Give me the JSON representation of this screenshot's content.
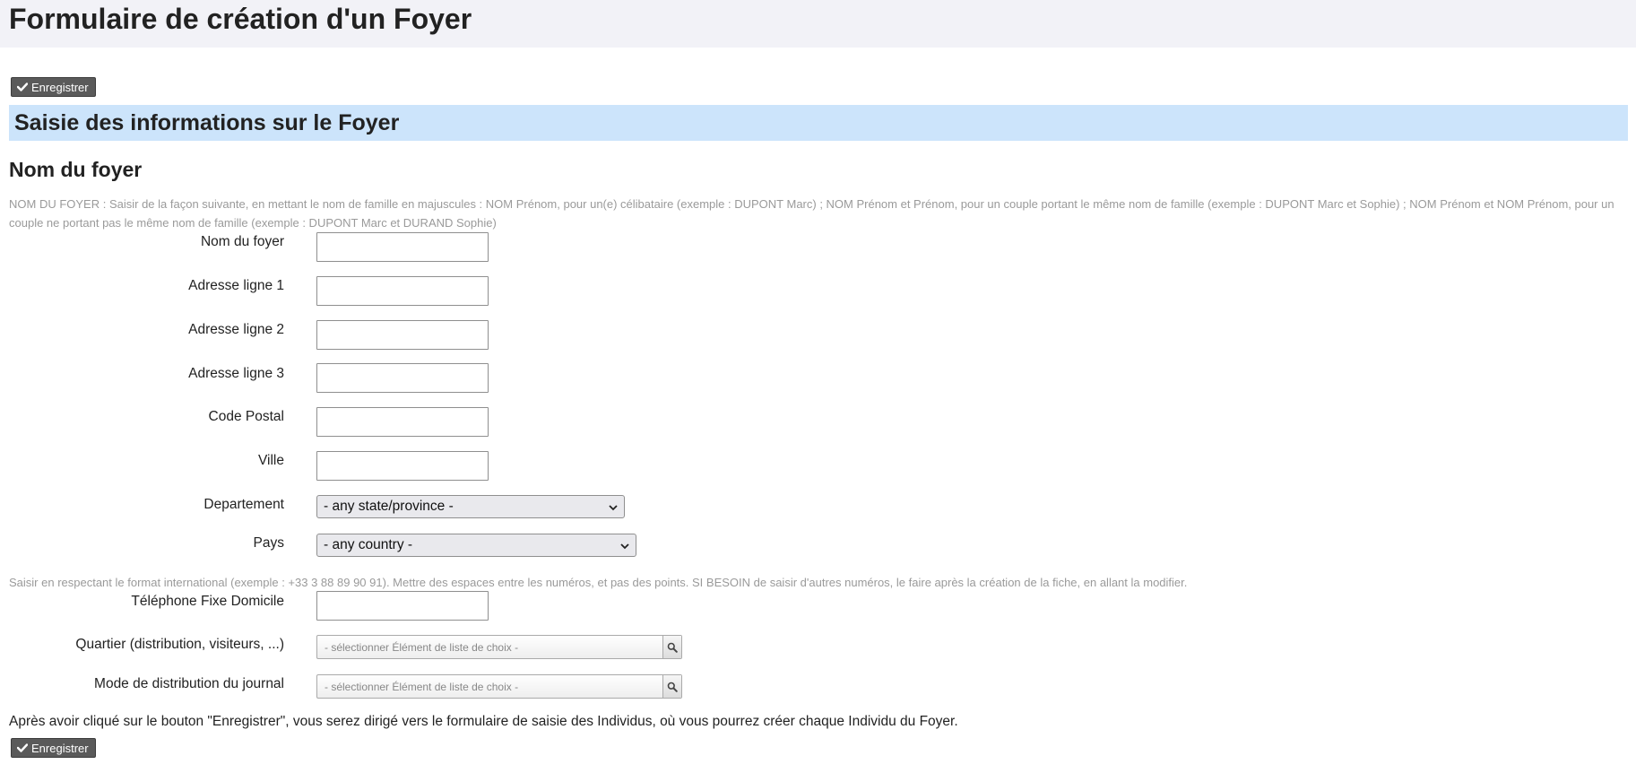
{
  "page": {
    "title": "Formulaire de création d'un Foyer"
  },
  "actions": {
    "save_label": "Enregistrer"
  },
  "section": {
    "title": "Saisie des informations sur le Foyer",
    "subtitle": "Nom du foyer"
  },
  "help": {
    "foyer": "NOM DU FOYER : Saisir de la façon suivante, en mettant le nom de famille en majuscules : NOM Prénom, pour un(e) célibataire (exemple : DUPONT Marc) ; NOM Prénom et Prénom, pour un couple portant le même nom de famille (exemple : DUPONT Marc et Sophie) ; NOM Prénom et NOM Prénom, pour un couple ne portant pas le même nom de famille (exemple : DUPONT Marc et DURAND Sophie)",
    "telephone": "Saisir en respectant le format international (exemple : +33 3 88 89 90 91). Mettre des espaces entre les numéros, et pas des points. SI BESOIN de saisir d'autres numéros, le faire après la création de la fiche, en allant la modifier."
  },
  "fields": {
    "nom_foyer": {
      "label": "Nom du foyer",
      "value": ""
    },
    "adresse1": {
      "label": "Adresse ligne 1",
      "value": ""
    },
    "adresse2": {
      "label": "Adresse ligne 2",
      "value": ""
    },
    "adresse3": {
      "label": "Adresse ligne 3",
      "value": ""
    },
    "code_postal": {
      "label": "Code Postal",
      "value": ""
    },
    "ville": {
      "label": "Ville",
      "value": ""
    },
    "departement": {
      "label": "Departement",
      "selected": "- any state/province -"
    },
    "pays": {
      "label": "Pays",
      "selected": "- any country -"
    },
    "telephone": {
      "label": "Téléphone Fixe Domicile",
      "value": ""
    },
    "quartier": {
      "label": "Quartier (distribution, visiteurs, ...)",
      "placeholder": "- sélectionner Élément de liste de choix -"
    },
    "mode_distribution": {
      "label": "Mode de distribution du journal",
      "placeholder": "- sélectionner Élément de liste de choix -"
    }
  },
  "footer": {
    "note": "Après avoir cliqué sur le bouton \"Enregistrer\", vous serez dirigé vers le formulaire de saisie des Individus, où vous pourrez créer chaque Individu du Foyer."
  },
  "icons": {
    "save": "check-icon",
    "select_arrow": "chevron-down-icon",
    "picker": "search-icon"
  },
  "colors": {
    "header_bg": "#f2f2f7",
    "section_bg": "#cce4fb",
    "button_bg": "#5a5a5a",
    "help_text": "#9a9a9a"
  }
}
